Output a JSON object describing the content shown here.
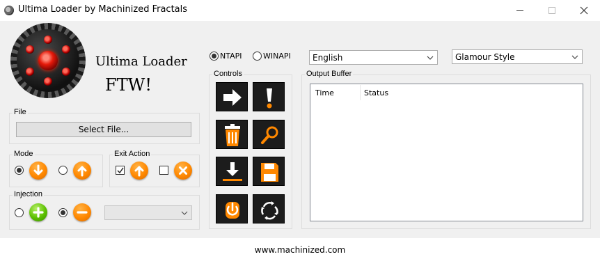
{
  "window": {
    "title": "Ultima Loader by Machinized Fractals"
  },
  "brand": {
    "title": "Ultima Loader",
    "subtitle": "FTW!"
  },
  "api": {
    "options": [
      {
        "label": "NTAPI",
        "checked": true
      },
      {
        "label": "WINAPI",
        "checked": false
      }
    ]
  },
  "language": {
    "selected": "English"
  },
  "style": {
    "selected": "Glamour Style"
  },
  "file_group": {
    "label": "File",
    "select_button": "Select File..."
  },
  "mode_group": {
    "label": "Mode",
    "options": [
      {
        "icon": "arrow-down-icon",
        "checked": true
      },
      {
        "icon": "arrow-up-icon",
        "checked": false
      }
    ]
  },
  "exit_group": {
    "label": "Exit Action",
    "options": [
      {
        "icon": "arrow-up-icon",
        "checked": true
      },
      {
        "icon": "close-icon",
        "checked": false
      }
    ]
  },
  "injection_group": {
    "label": "Injection",
    "options": [
      {
        "icon": "plus-icon",
        "checked": false
      },
      {
        "icon": "minus-icon",
        "checked": true
      }
    ],
    "process_value": ""
  },
  "controls": {
    "label": "Controls",
    "buttons": [
      "arrow-right-icon",
      "exclamation-icon",
      "trash-icon",
      "search-icon",
      "download-icon",
      "save-icon",
      "power-icon",
      "refresh-icon"
    ]
  },
  "output": {
    "label": "Output Buffer",
    "columns": [
      "Time",
      "Status"
    ],
    "rows": []
  },
  "footer": {
    "url": "www.machinized.com"
  },
  "colors": {
    "accent_orange": "#ff8800",
    "accent_green": "#5cc000",
    "button_dark": "#1c1c1c"
  }
}
